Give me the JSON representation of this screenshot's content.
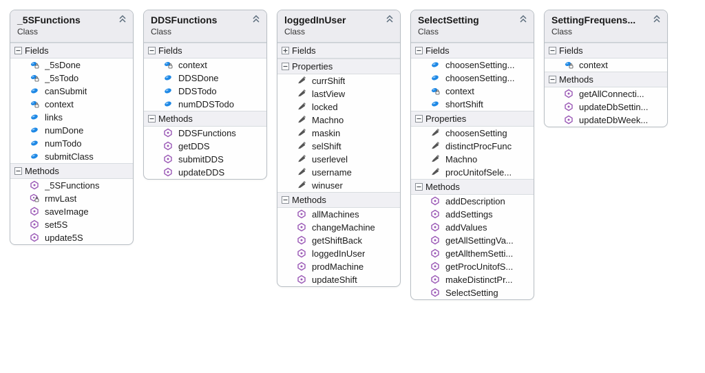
{
  "classes": [
    {
      "name": "_5SFunctions",
      "kind": "Class",
      "sections": [
        {
          "title": "Fields",
          "toggle": "collapse",
          "members": [
            {
              "icon": "field-private",
              "label": "_5sDone"
            },
            {
              "icon": "field-private",
              "label": "_5sTodo"
            },
            {
              "icon": "field-public",
              "label": "canSubmit"
            },
            {
              "icon": "field-private",
              "label": "context"
            },
            {
              "icon": "field-public",
              "label": "links"
            },
            {
              "icon": "field-public",
              "label": "numDone"
            },
            {
              "icon": "field-public",
              "label": "numTodo"
            },
            {
              "icon": "field-public",
              "label": "submitClass"
            }
          ]
        },
        {
          "title": "Methods",
          "toggle": "collapse",
          "members": [
            {
              "icon": "method",
              "label": "_5SFunctions"
            },
            {
              "icon": "method-private",
              "label": "rmvLast"
            },
            {
              "icon": "method",
              "label": "saveImage"
            },
            {
              "icon": "method",
              "label": "set5S"
            },
            {
              "icon": "method",
              "label": "update5S"
            }
          ]
        }
      ]
    },
    {
      "name": "DDSFunctions",
      "kind": "Class",
      "sections": [
        {
          "title": "Fields",
          "toggle": "collapse",
          "members": [
            {
              "icon": "field-private",
              "label": "context"
            },
            {
              "icon": "field-public",
              "label": "DDSDone"
            },
            {
              "icon": "field-public",
              "label": "DDSTodo"
            },
            {
              "icon": "field-public",
              "label": "numDDSTodo"
            }
          ]
        },
        {
          "title": "Methods",
          "toggle": "collapse",
          "members": [
            {
              "icon": "method",
              "label": "DDSFunctions"
            },
            {
              "icon": "method",
              "label": "getDDS"
            },
            {
              "icon": "method",
              "label": "submitDDS"
            },
            {
              "icon": "method",
              "label": "updateDDS"
            }
          ]
        }
      ]
    },
    {
      "name": "loggedInUser",
      "kind": "Class",
      "sections": [
        {
          "title": "Fields",
          "toggle": "expand",
          "members": []
        },
        {
          "title": "Properties",
          "toggle": "collapse",
          "members": [
            {
              "icon": "property",
              "label": "currShift"
            },
            {
              "icon": "property",
              "label": "lastView"
            },
            {
              "icon": "property",
              "label": "locked"
            },
            {
              "icon": "property",
              "label": "Machno"
            },
            {
              "icon": "property",
              "label": "maskin"
            },
            {
              "icon": "property",
              "label": "selShift"
            },
            {
              "icon": "property",
              "label": "userlevel"
            },
            {
              "icon": "property",
              "label": "username"
            },
            {
              "icon": "property",
              "label": "winuser"
            }
          ]
        },
        {
          "title": "Methods",
          "toggle": "collapse",
          "members": [
            {
              "icon": "method",
              "label": "allMachines"
            },
            {
              "icon": "method",
              "label": "changeMachine"
            },
            {
              "icon": "method",
              "label": "getShiftBack"
            },
            {
              "icon": "method",
              "label": "loggedInUser"
            },
            {
              "icon": "method",
              "label": "prodMachine"
            },
            {
              "icon": "method",
              "label": "updateShift"
            }
          ]
        }
      ]
    },
    {
      "name": "SelectSetting",
      "kind": "Class",
      "sections": [
        {
          "title": "Fields",
          "toggle": "collapse",
          "members": [
            {
              "icon": "field-public",
              "label": "choosenSetting..."
            },
            {
              "icon": "field-public",
              "label": "choosenSetting..."
            },
            {
              "icon": "field-private",
              "label": "context"
            },
            {
              "icon": "field-public",
              "label": "shortShift"
            }
          ]
        },
        {
          "title": "Properties",
          "toggle": "collapse",
          "members": [
            {
              "icon": "property",
              "label": "choosenSetting"
            },
            {
              "icon": "property",
              "label": "distinctProcFunc"
            },
            {
              "icon": "property",
              "label": "Machno"
            },
            {
              "icon": "property",
              "label": "procUnitofSele..."
            }
          ]
        },
        {
          "title": "Methods",
          "toggle": "collapse",
          "members": [
            {
              "icon": "method",
              "label": "addDescription"
            },
            {
              "icon": "method",
              "label": "addSettings"
            },
            {
              "icon": "method",
              "label": "addValues"
            },
            {
              "icon": "method",
              "label": "getAllSettingVa..."
            },
            {
              "icon": "method",
              "label": "getAllthemSetti..."
            },
            {
              "icon": "method",
              "label": "getProcUnitofS..."
            },
            {
              "icon": "method",
              "label": "makeDistinctPr..."
            },
            {
              "icon": "method",
              "label": "SelectSetting"
            }
          ]
        }
      ]
    },
    {
      "name": "SettingFrequens...",
      "kind": "Class",
      "sections": [
        {
          "title": "Fields",
          "toggle": "collapse",
          "members": [
            {
              "icon": "field-private",
              "label": "context"
            }
          ]
        },
        {
          "title": "Methods",
          "toggle": "collapse",
          "members": [
            {
              "icon": "method",
              "label": "getAllConnecti..."
            },
            {
              "icon": "method",
              "label": "updateDbSettin..."
            },
            {
              "icon": "method",
              "label": "updateDbWeek..."
            }
          ]
        }
      ]
    }
  ]
}
